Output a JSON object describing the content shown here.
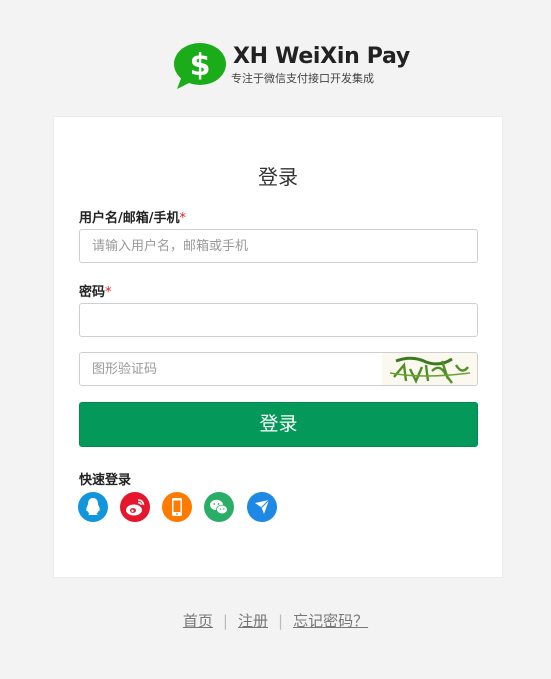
{
  "brand": {
    "title": "XH WeiXin Pay",
    "subtitle": "专注于微信支付接口开发集成",
    "logo_icon": "dollar-chat-icon",
    "logo_color": "#1aad19"
  },
  "login_form": {
    "title": "登录",
    "username_label": "用户名/邮箱/手机",
    "username_required_mark": "*",
    "username_placeholder": "请输入用户名，邮箱或手机",
    "username_value": "",
    "password_label": "密码",
    "password_required_mark": "*",
    "password_value": "",
    "captcha_placeholder": "图形验证码",
    "captcha_value": "",
    "submit_label": "登录",
    "submit_color": "#04995a"
  },
  "quick_login": {
    "label": "快速登录",
    "providers": [
      {
        "icon": "qq-icon",
        "color": "#1296db"
      },
      {
        "icon": "weibo-icon",
        "color": "#e6162d"
      },
      {
        "icon": "mobile-phone-icon",
        "color": "#ff7b00"
      },
      {
        "icon": "wechat-icon",
        "color": "#2aae67"
      },
      {
        "icon": "alipay-icon",
        "color": "#1e88e5"
      }
    ]
  },
  "footer": {
    "home": "首页",
    "register": "注册",
    "forgot_password": "忘记密码？",
    "separator": "|"
  }
}
